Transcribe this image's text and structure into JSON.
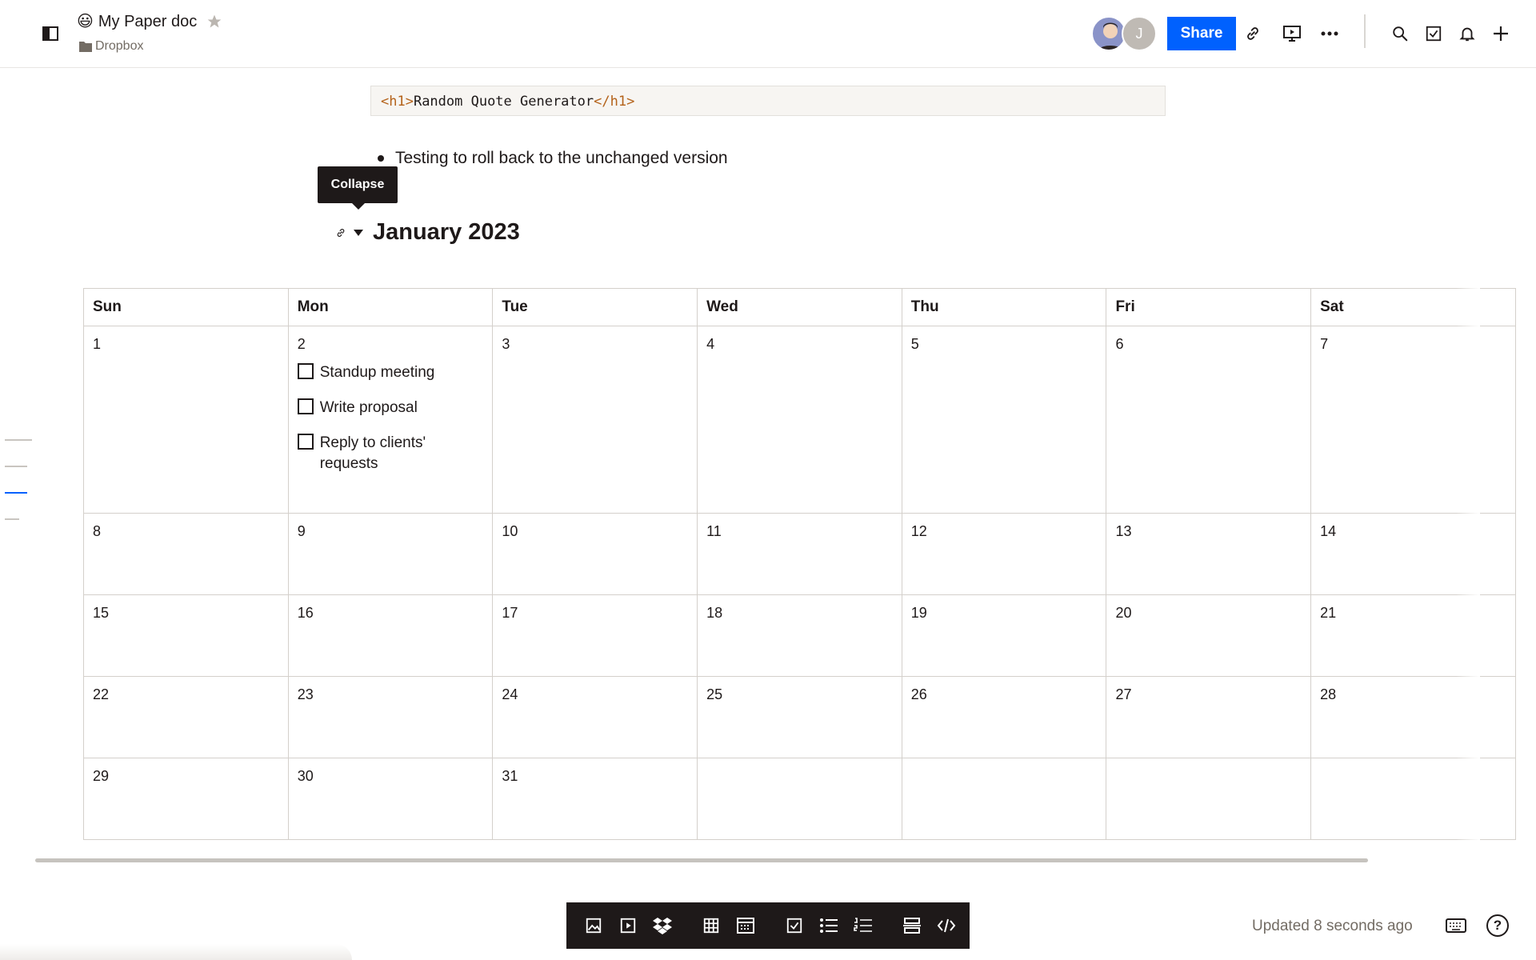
{
  "header": {
    "doc_emoji": "😃",
    "doc_title": "My Paper doc",
    "location": "Dropbox",
    "avatar_initial": "J",
    "share_label": "Share"
  },
  "content": {
    "code_open_tag": "<h1>",
    "code_text": "Random Quote Generator",
    "code_close_tag": "</h1>",
    "bullet_text": "Testing to roll back to the unchanged version",
    "tooltip": "Collapse",
    "heading": "January 2023"
  },
  "calendar": {
    "days": [
      "Sun",
      "Mon",
      "Tue",
      "Wed",
      "Thu",
      "Fri",
      "Sat"
    ],
    "weeks": [
      [
        "1",
        "2",
        "3",
        "4",
        "5",
        "6",
        "7"
      ],
      [
        "8",
        "9",
        "10",
        "11",
        "12",
        "13",
        "14"
      ],
      [
        "15",
        "16",
        "17",
        "18",
        "19",
        "20",
        "21"
      ],
      [
        "22",
        "23",
        "24",
        "25",
        "26",
        "27",
        "28"
      ],
      [
        "29",
        "30",
        "31",
        "",
        "",
        "",
        ""
      ]
    ],
    "tasks": [
      "Standup meeting",
      "Write proposal",
      "Reply to clients' requests"
    ]
  },
  "footer": {
    "updated": "Updated 8 seconds ago",
    "help": "?"
  },
  "colors": {
    "accent": "#0061fe",
    "toolbar_bg": "#1e1919",
    "text": "#1e1919"
  }
}
